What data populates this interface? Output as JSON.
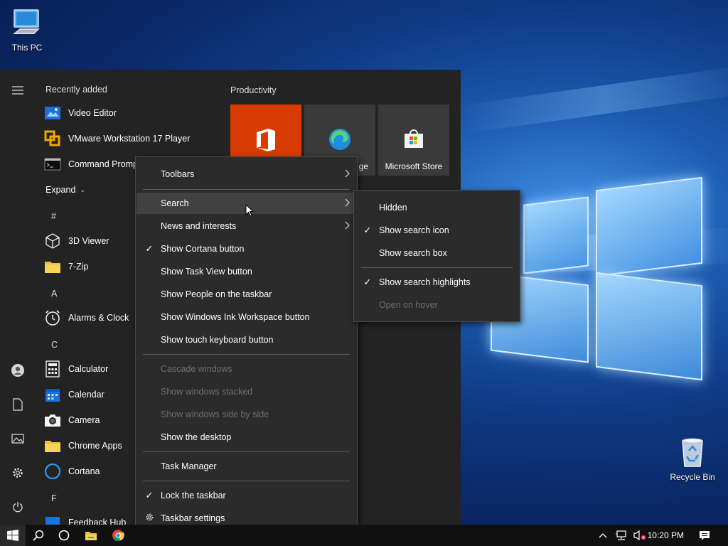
{
  "desktop": {
    "this_pc_label": "This PC",
    "recycle_bin_label": "Recycle Bin"
  },
  "start_menu": {
    "recently_added_heading": "Recently added",
    "recently_added": [
      {
        "label": "Video Editor",
        "icon": "video-editor-icon"
      },
      {
        "label": "VMware Workstation 17 Player",
        "icon": "vmware-icon"
      },
      {
        "label": "Command Prompt",
        "icon": "command-prompt-icon"
      }
    ],
    "expand_label": "Expand",
    "groups": [
      {
        "letter": "#",
        "apps": [
          {
            "label": "3D Viewer",
            "icon": "3d-viewer-icon"
          },
          {
            "label": "7-Zip",
            "icon": "folder-icon"
          }
        ]
      },
      {
        "letter": "A",
        "apps": [
          {
            "label": "Alarms & Clock",
            "icon": "alarm-clock-icon"
          }
        ]
      },
      {
        "letter": "C",
        "apps": [
          {
            "label": "Calculator",
            "icon": "calculator-icon"
          },
          {
            "label": "Calendar",
            "icon": "calendar-icon"
          },
          {
            "label": "Camera",
            "icon": "camera-icon"
          },
          {
            "label": "Chrome Apps",
            "icon": "folder-icon"
          },
          {
            "label": "Cortana",
            "icon": "cortana-icon"
          }
        ]
      },
      {
        "letter": "F",
        "apps": [
          {
            "label": "Feedback Hub",
            "icon": "feedback-hub-icon"
          }
        ]
      }
    ],
    "tiles_heading": "Productivity",
    "tiles": [
      {
        "label": "",
        "icon": "office-icon",
        "color": "#d83b01"
      },
      {
        "label": "ge",
        "icon": "edge-icon",
        "color": "#3a3a3a"
      },
      {
        "label": "Microsoft Store",
        "icon": "store-icon",
        "color": "#3a3a3a"
      }
    ]
  },
  "context_menu": {
    "items": [
      {
        "label": "Toolbars",
        "checked": false,
        "submenu": true,
        "disabled": false
      },
      {
        "label": "Search",
        "checked": false,
        "submenu": true,
        "disabled": false,
        "hover": true
      },
      {
        "label": "News and interests",
        "checked": false,
        "submenu": true,
        "disabled": false
      },
      {
        "label": "Show Cortana button",
        "checked": true,
        "submenu": false,
        "disabled": false
      },
      {
        "label": "Show Task View button",
        "checked": false,
        "submenu": false,
        "disabled": false
      },
      {
        "label": "Show People on the taskbar",
        "checked": false,
        "submenu": false,
        "disabled": false
      },
      {
        "label": "Show Windows Ink Workspace button",
        "checked": false,
        "submenu": false,
        "disabled": false
      },
      {
        "label": "Show touch keyboard button",
        "checked": false,
        "submenu": false,
        "disabled": false
      },
      {
        "label": "Cascade windows",
        "checked": false,
        "submenu": false,
        "disabled": true
      },
      {
        "label": "Show windows stacked",
        "checked": false,
        "submenu": false,
        "disabled": true
      },
      {
        "label": "Show windows side by side",
        "checked": false,
        "submenu": false,
        "disabled": true
      },
      {
        "label": "Show the desktop",
        "checked": false,
        "submenu": false,
        "disabled": false
      },
      {
        "label": "Task Manager",
        "checked": false,
        "submenu": false,
        "disabled": false
      },
      {
        "label": "Lock the taskbar",
        "checked": true,
        "submenu": false,
        "disabled": false
      },
      {
        "label": "Taskbar settings",
        "checked": false,
        "submenu": false,
        "disabled": false,
        "icon": "gear-icon"
      }
    ]
  },
  "search_submenu": {
    "items": [
      {
        "label": "Hidden",
        "checked": false,
        "disabled": false
      },
      {
        "label": "Show search icon",
        "checked": true,
        "disabled": false
      },
      {
        "label": "Show search box",
        "checked": false,
        "disabled": false
      },
      {
        "label": "Show search highlights",
        "checked": true,
        "disabled": false
      },
      {
        "label": "Open on hover",
        "checked": false,
        "disabled": true
      }
    ]
  },
  "taskbar": {
    "clock": "10:20 PM"
  },
  "colors": {
    "menu_bg": "#2b2b2b",
    "start_bg": "#232323",
    "taskbar_bg": "#101010",
    "office_tile": "#d83b01",
    "accent": "#0078d7"
  }
}
